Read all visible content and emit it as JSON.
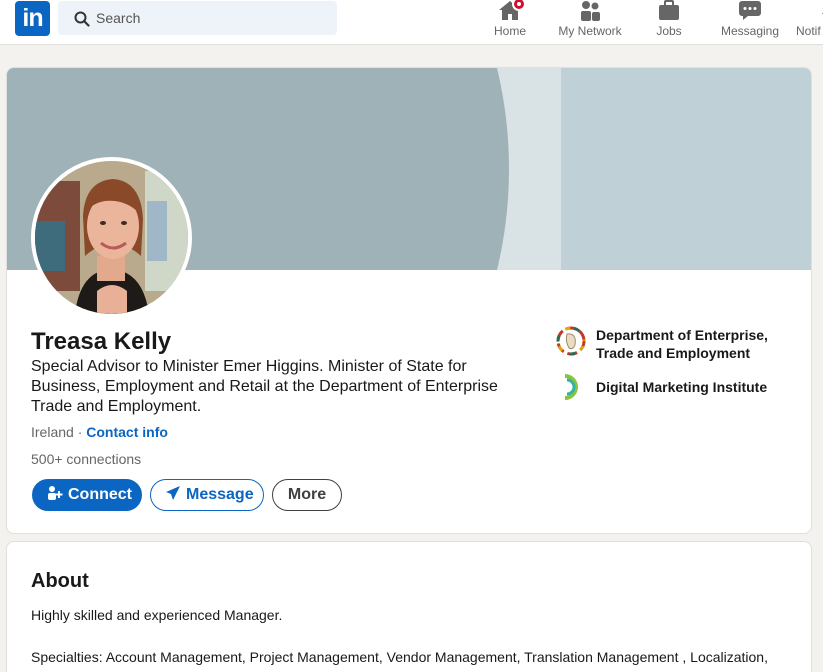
{
  "nav": {
    "logo_text": "in",
    "search_placeholder": "Search",
    "items": [
      {
        "label": "Home",
        "icon": "home-icon"
      },
      {
        "label": "My Network",
        "icon": "network-icon"
      },
      {
        "label": "Jobs",
        "icon": "briefcase-icon"
      },
      {
        "label": "Messaging",
        "icon": "messaging-icon"
      },
      {
        "label": "Notif",
        "icon": "bell-icon"
      }
    ]
  },
  "profile": {
    "name": "Treasa Kelly",
    "headline": "Special Advisor to Minister Emer Higgins. Minister of State for Business, Employment and Retail at the Department of Enterprise Trade and Employment.",
    "location": "Ireland",
    "separator": "·",
    "contact_info": "Contact info",
    "connections": "500+ connections",
    "buttons": {
      "connect": "Connect",
      "message": "Message",
      "more": "More"
    },
    "organizations": [
      {
        "name_line1": "Department of Enterprise,",
        "name_line2": "Trade and Employment"
      },
      {
        "name_line1": "Digital Marketing Institute"
      }
    ]
  },
  "about": {
    "title": "About",
    "summary": "Highly skilled and experienced Manager.",
    "specialties": "Specialties: Account Management, Project Management, Vendor Management, Translation Management , Localization, Retail Planning, Manager, Supply Chain Management, Client Relations, Brand, Manager, Marketing, Accounts, E"
  },
  "colors": {
    "brand": "#0a66c2",
    "badge": "#cb112d",
    "banner": "#bfd1d6"
  }
}
